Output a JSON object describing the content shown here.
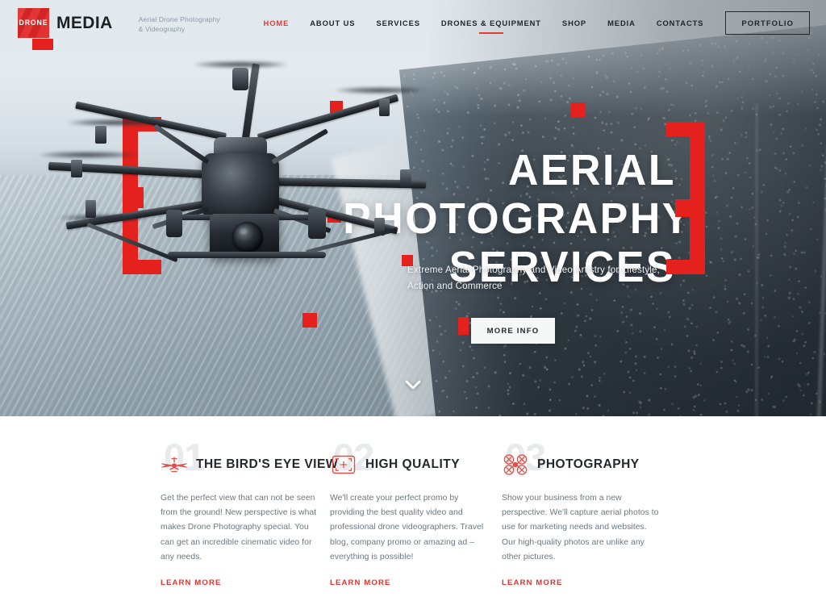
{
  "brand": {
    "logo_text": "DRONE",
    "name": "MEDIA",
    "tagline_line1": "Aerial Drone Photography",
    "tagline_line2": "& Videography"
  },
  "colors": {
    "accent_red": "#e4211c",
    "nav_active": "#e63a32",
    "logo_red": "#e02626",
    "text_dark": "#23282c",
    "body_gray": "#6b7880",
    "watermark_gray": "#e9eaeb"
  },
  "nav": {
    "items": [
      {
        "label": "HOME",
        "active": true,
        "underlined": false
      },
      {
        "label": "ABOUT US",
        "active": false,
        "underlined": false
      },
      {
        "label": "SERVICES",
        "active": false,
        "underlined": false
      },
      {
        "label": "DRONES & EQUIPMENT",
        "active": false,
        "underlined": true
      },
      {
        "label": "SHOP",
        "active": false,
        "underlined": false
      },
      {
        "label": "MEDIA",
        "active": false,
        "underlined": false
      },
      {
        "label": "CONTACTS",
        "active": false,
        "underlined": false
      }
    ],
    "cta_label": "PORTFOLIO"
  },
  "hero": {
    "title_line1": "AERIAL PHOTOGRAPHY",
    "title_line2": "SERVICES",
    "subtitle": "Extreme Aerial Photography and Video Artistry for Lifestyle, Action and Commerce",
    "button_label": "MORE INFO",
    "scroll_icon": "chevron-down-icon",
    "decor": {
      "left_bracket": "[",
      "right_bracket": "]"
    }
  },
  "features": [
    {
      "number": "01",
      "icon": "drone-top-view-icon",
      "title": "THE BIRD'S EYE VIEW",
      "body": "Get the perfect view that can not be seen from the ground! New perspective is what makes Drone Photography special. You can get an incredible cinematic video for any needs.",
      "link_label": "LEARN MORE"
    },
    {
      "number": "02",
      "icon": "viewfinder-frame-icon",
      "title": "HIGH QUALITY",
      "body": "We'll create your perfect promo by providing the best quality video and professional drone videographers. Travel blog, company promo or amazing ad – everything is possible!",
      "link_label": "LEARN MORE"
    },
    {
      "number": "03",
      "icon": "quadcopter-icon",
      "title": "PHOTOGRAPHY",
      "body": "Show your business from a new perspective. We'll capture aerial photos to use for marketing needs and websites. Our high-quality photos are unlike any other pictures.",
      "link_label": "LEARN MORE"
    }
  ]
}
